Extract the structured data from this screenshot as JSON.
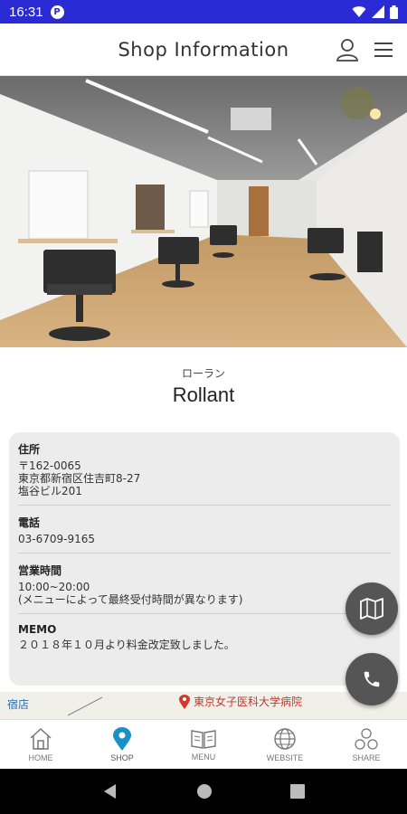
{
  "status": {
    "time": "16:31",
    "app_icon": "P"
  },
  "header": {
    "title": "Shop Information"
  },
  "shop": {
    "kana": "ローラン",
    "name": "Rollant"
  },
  "info": {
    "address_label": "住所",
    "address_postal": "〒162-0065",
    "address_line1": "東京都新宿区住吉町8-27",
    "address_line2": "塩谷ビル201",
    "phone_label": "電話",
    "phone_value": "03-6709-9165",
    "hours_label": "営業時間",
    "hours_value": "10:00~20:00",
    "hours_note": "(メニューによって最終受付時間が異なります)",
    "memo_label": "MEMO",
    "memo_value": "２０１８年１０月より料金改定致しました。"
  },
  "map": {
    "poi_label": "東京女子医科大学病院",
    "station_label": "宿店"
  },
  "tabs": [
    {
      "label": "HOME",
      "icon": "home-icon"
    },
    {
      "label": "SHOP",
      "icon": "location-pin-icon"
    },
    {
      "label": "MENU",
      "icon": "book-icon"
    },
    {
      "label": "WEBSITE",
      "icon": "globe-icon"
    },
    {
      "label": "SHARE",
      "icon": "share-icon"
    }
  ],
  "colors": {
    "status_bar": "#2b2bd6",
    "accent_blue": "#1a90c8",
    "fab": "#555555"
  }
}
